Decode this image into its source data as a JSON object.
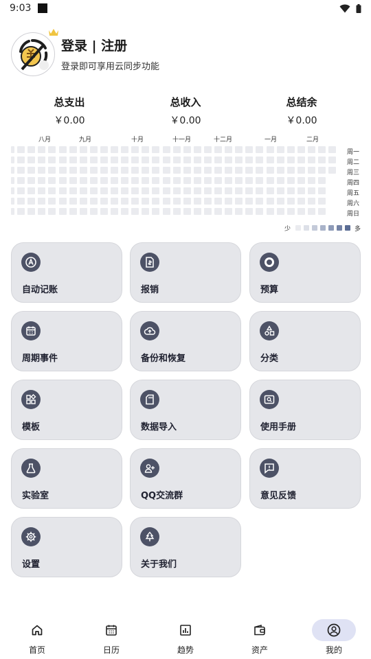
{
  "status_bar": {
    "time": "9:03"
  },
  "profile": {
    "title": "登录 | 注册",
    "subtitle": "登录即可享用云同步功能"
  },
  "totals": [
    {
      "label": "总支出",
      "value": "￥0.00"
    },
    {
      "label": "总收入",
      "value": "￥0.00"
    },
    {
      "label": "总结余",
      "value": "￥0.00"
    }
  ],
  "heatmap": {
    "months": [
      "八月",
      "九月",
      "十月",
      "十一月",
      "十二月",
      "一月",
      "二月"
    ],
    "weekdays": [
      "周一",
      "周二",
      "周三",
      "周四",
      "周五",
      "周六",
      "周日"
    ],
    "legend_less": "少",
    "legend_more": "多",
    "legend_colors": [
      "#eaebef",
      "#dde0e8",
      "#c4cad9",
      "#a9b3c9",
      "#8e9bb8",
      "#7483a6",
      "#5a6c94"
    ],
    "cell_color": "#eaebef"
  },
  "features": [
    {
      "label": "自动记账",
      "icon": "auto-a-icon"
    },
    {
      "label": "报销",
      "icon": "receipt-icon"
    },
    {
      "label": "预算",
      "icon": "ring-icon"
    },
    {
      "label": "周期事件",
      "icon": "calendar-icon"
    },
    {
      "label": "备份和恢复",
      "icon": "cloud-upload-icon"
    },
    {
      "label": "分类",
      "icon": "shapes-icon"
    },
    {
      "label": "模板",
      "icon": "widgets-icon"
    },
    {
      "label": "数据导入",
      "icon": "sd-card-icon"
    },
    {
      "label": "使用手册",
      "icon": "manual-search-icon"
    },
    {
      "label": "实验室",
      "icon": "flask-icon"
    },
    {
      "label": "QQ交流群",
      "icon": "group-add-icon"
    },
    {
      "label": "意见反馈",
      "icon": "feedback-icon"
    },
    {
      "label": "设置",
      "icon": "gear-icon"
    },
    {
      "label": "关于我们",
      "icon": "tree-icon"
    }
  ],
  "nav": [
    {
      "label": "首页",
      "icon": "home-icon"
    },
    {
      "label": "日历",
      "icon": "calendar-icon"
    },
    {
      "label": "趋势",
      "icon": "chart-icon"
    },
    {
      "label": "资产",
      "icon": "wallet-icon"
    },
    {
      "label": "我的",
      "icon": "account-icon"
    }
  ],
  "colors": {
    "card_bg": "#e5e6ea",
    "icon_bg": "#4d5266",
    "nav_active": "#dfe2f4"
  }
}
